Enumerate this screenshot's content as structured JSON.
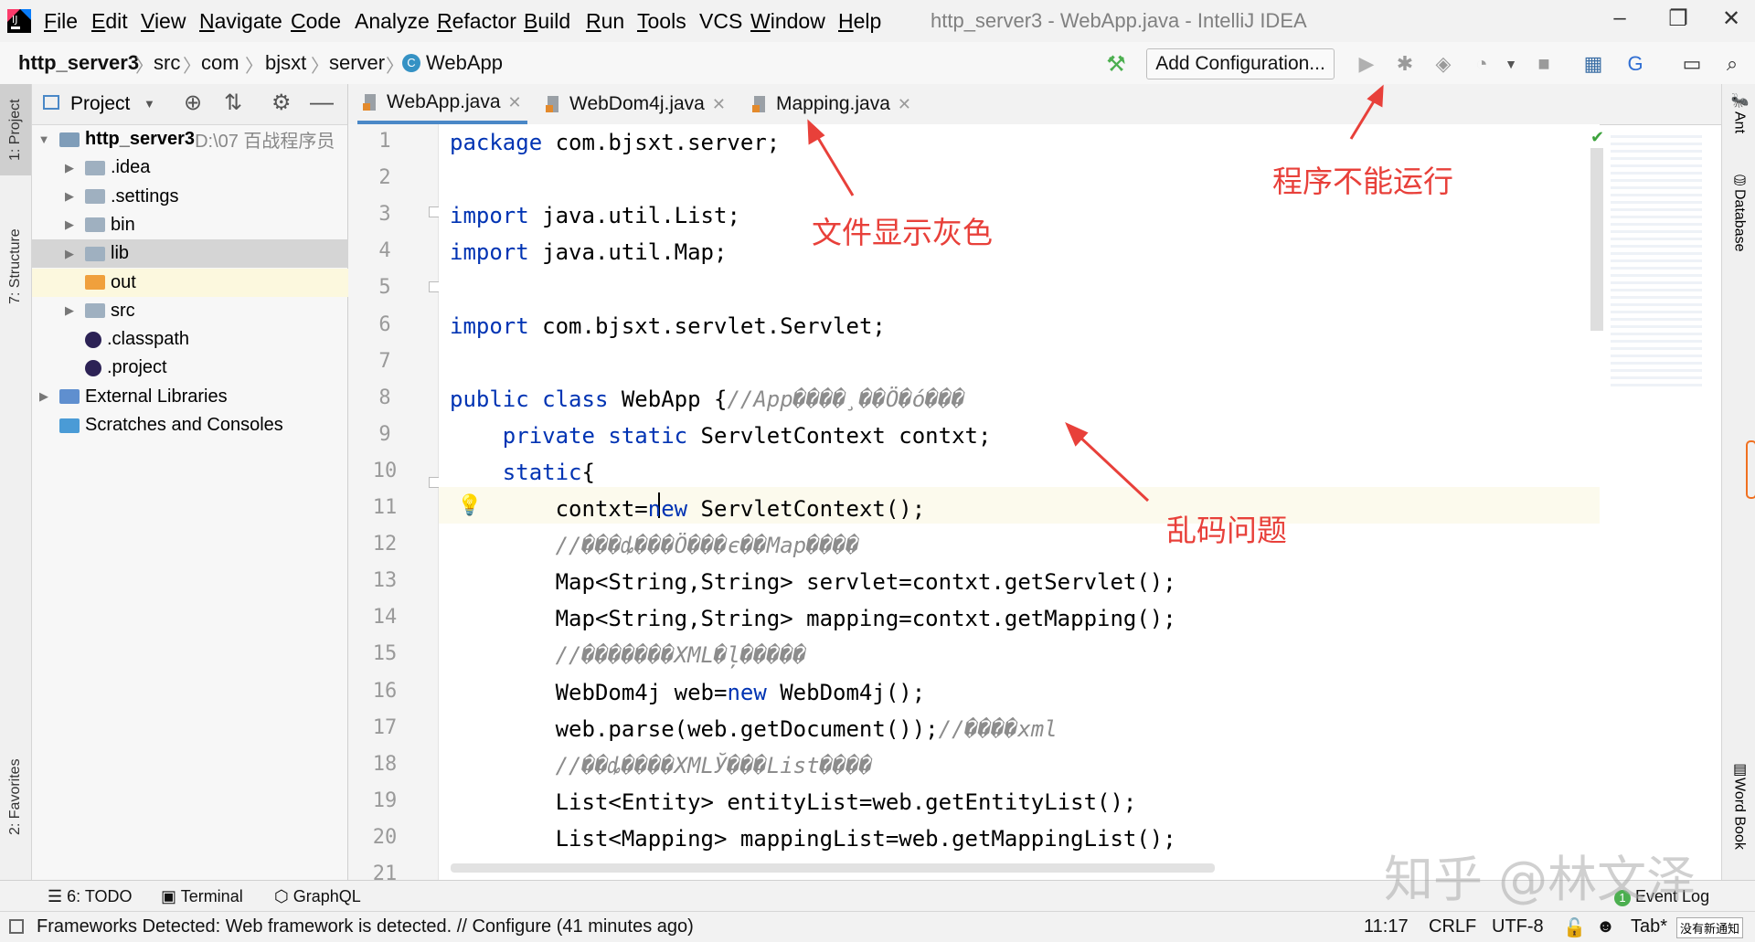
{
  "menubar": {
    "items": [
      {
        "label": "File",
        "key": "F",
        "rest": "ile"
      },
      {
        "label": "Edit",
        "key": "E",
        "rest": "dit"
      },
      {
        "label": "View",
        "key": "V",
        "rest": "iew"
      },
      {
        "label": "Navigate",
        "key": "N",
        "rest": "avigate"
      },
      {
        "label": "Code",
        "key": "C",
        "rest": "ode"
      },
      {
        "label": "Analyze",
        "key": "",
        "rest": "Analyze"
      },
      {
        "label": "Refactor",
        "key": "R",
        "rest": "efactor"
      },
      {
        "label": "Build",
        "key": "B",
        "rest": "uild"
      },
      {
        "label": "Run",
        "key": "R",
        "rest": "un"
      },
      {
        "label": "Tools",
        "key": "T",
        "rest": "ools"
      },
      {
        "label": "VCS",
        "key": "",
        "rest": "VCS"
      },
      {
        "label": "Window",
        "key": "W",
        "rest": "indow"
      },
      {
        "label": "Help",
        "key": "H",
        "rest": "elp"
      }
    ],
    "title": "http_server3 - WebApp.java - IntelliJ IDEA",
    "controls": {
      "minimize": "–",
      "maximize": "❐",
      "close": "✕"
    }
  },
  "navbar": {
    "breadcrumbs": [
      "http_server3",
      "src",
      "com",
      "bjsxt",
      "server",
      "WebApp"
    ],
    "add_configuration": "Add Configuration..."
  },
  "left_stripe": {
    "project": "1: Project",
    "structure": "7: Structure",
    "favorites": "2: Favorites"
  },
  "right_stripe": {
    "ant": "Ant",
    "database": "Database",
    "word_book": "Word Book"
  },
  "project_panel": {
    "title": "Project",
    "tree": [
      {
        "label": "http_server3",
        "extra": "D:\\07 百战程序员",
        "indent": 0,
        "arrow": "▼",
        "icon": "module"
      },
      {
        "label": ".idea",
        "indent": 1,
        "arrow": "▶",
        "icon": "folder"
      },
      {
        "label": ".settings",
        "indent": 1,
        "arrow": "▶",
        "icon": "folder"
      },
      {
        "label": "bin",
        "indent": 1,
        "arrow": "▶",
        "icon": "folder"
      },
      {
        "label": "lib",
        "indent": 1,
        "arrow": "▶",
        "icon": "folder"
      },
      {
        "label": "out",
        "indent": 1,
        "arrow": "",
        "icon": "folder-orange"
      },
      {
        "label": "src",
        "indent": 1,
        "arrow": "▶",
        "icon": "folder"
      },
      {
        "label": ".classpath",
        "indent": 1,
        "arrow": "",
        "icon": "eclipse"
      },
      {
        "label": ".project",
        "indent": 1,
        "arrow": "",
        "icon": "eclipse"
      },
      {
        "label": "External Libraries",
        "indent": 0,
        "arrow": "▶",
        "icon": "libraries"
      },
      {
        "label": "Scratches and Consoles",
        "indent": 0,
        "arrow": "",
        "icon": "scratches"
      }
    ]
  },
  "editor": {
    "tabs": [
      {
        "label": "WebApp.java",
        "active": true
      },
      {
        "label": "WebDom4j.java",
        "active": false
      },
      {
        "label": "Mapping.java",
        "active": false
      }
    ],
    "line_numbers": [
      "1",
      "2",
      "3",
      "4",
      "5",
      "6",
      "7",
      "8",
      "9",
      "10",
      "11",
      "12",
      "13",
      "14",
      "15",
      "16",
      "17",
      "18",
      "19",
      "20",
      "21"
    ],
    "lines": [
      [
        {
          "t": "package ",
          "c": "kw"
        },
        {
          "t": "com.bjsxt.server;",
          "c": ""
        }
      ],
      [],
      [
        {
          "t": "import ",
          "c": "kw"
        },
        {
          "t": "java.util.List;",
          "c": ""
        }
      ],
      [
        {
          "t": "import ",
          "c": "kw"
        },
        {
          "t": "java.util.Map;",
          "c": ""
        }
      ],
      [],
      [
        {
          "t": "import ",
          "c": "kw"
        },
        {
          "t": "com.bjsxt.servlet.Servlet;",
          "c": ""
        }
      ],
      [],
      [
        {
          "t": "public class ",
          "c": "kw"
        },
        {
          "t": "WebApp {",
          "c": ""
        },
        {
          "t": "//App����¸��Ö�ó���",
          "c": "cm"
        }
      ],
      [
        {
          "t": "    private static ",
          "c": "kw"
        },
        {
          "t": "ServletContext contxt;",
          "c": ""
        }
      ],
      [
        {
          "t": "    static",
          "c": "kw"
        },
        {
          "t": "{",
          "c": ""
        }
      ],
      [
        {
          "t": "        contxt=",
          "c": ""
        },
        {
          "t": "new ",
          "c": "kw"
        },
        {
          "t": "ServletContext();",
          "c": ""
        }
      ],
      [
        {
          "t": "        //���ȡ���Ö���є��Map����",
          "c": "cm"
        }
      ],
      [
        {
          "t": "        Map<String,String> servlet=contxt.getServlet();",
          "c": ""
        }
      ],
      [
        {
          "t": "        Map<String,String> mapping=contxt.getMapping();",
          "c": ""
        }
      ],
      [
        {
          "t": "        //�������XML�ļ�����",
          "c": "cm"
        }
      ],
      [
        {
          "t": "        WebDom4j web=",
          "c": ""
        },
        {
          "t": "new ",
          "c": "kw"
        },
        {
          "t": "WebDom4j();",
          "c": ""
        }
      ],
      [
        {
          "t": "        web.parse(web.getDocument());",
          "c": ""
        },
        {
          "t": "//����xml",
          "c": "cm"
        }
      ],
      [
        {
          "t": "        //��ȡ����XMLЎ���List����",
          "c": "cm"
        }
      ],
      [
        {
          "t": "        List<Entity> entityList=web.getEntityList();",
          "c": ""
        }
      ],
      [
        {
          "t": "        List<Mapping> mappingList=web.getMappingList();",
          "c": ""
        }
      ],
      []
    ]
  },
  "annotations": {
    "gray_file": "文件显示灰色",
    "cannot_run": "程序不能运行",
    "garbled": "乱码问题"
  },
  "tool_tabs": {
    "todo": "6: TODO",
    "terminal": "Terminal",
    "graphql": "GraphQL",
    "event_log": "Event Log",
    "event_count": "1"
  },
  "statusbar": {
    "message": "Frameworks Detected: Web framework is detected. // Configure (41 minutes ago)",
    "position": "11:17",
    "line_sep": "CRLF",
    "encoding": "UTF-8",
    "indent": "Tab*",
    "notice": "没有新通知"
  },
  "watermark": "知乎 @林文泽"
}
